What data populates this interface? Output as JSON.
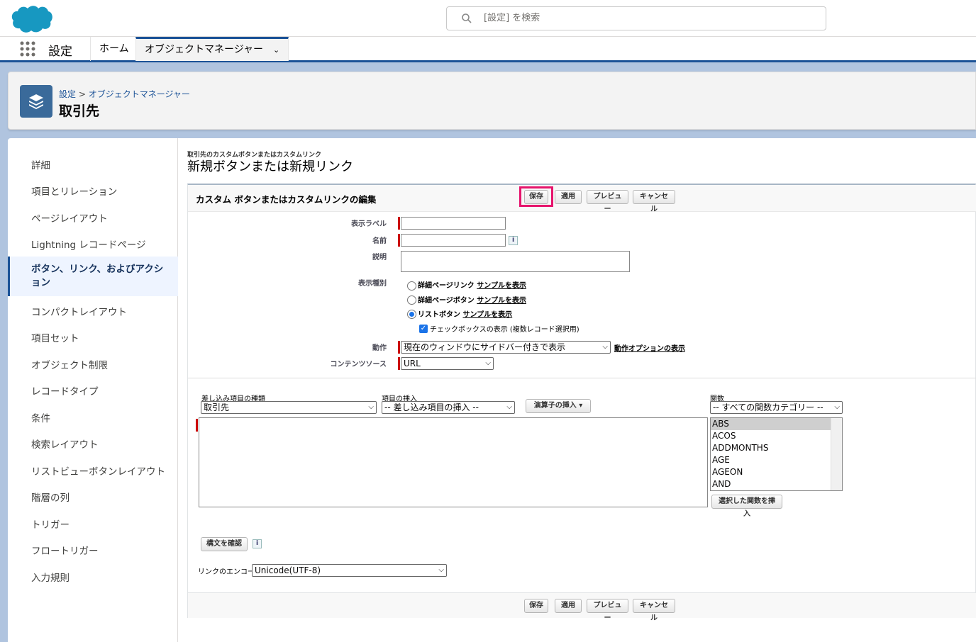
{
  "header": {
    "search_placeholder": "[設定] を検索"
  },
  "nav": {
    "app_name": "設定",
    "tabs": [
      {
        "label": "ホーム"
      },
      {
        "label": "オブジェクトマネージャー"
      }
    ]
  },
  "page_header": {
    "breadcrumb_setup": "設定",
    "breadcrumb_sep": ">",
    "breadcrumb_objmgr": "オブジェクトマネージャー",
    "title": "取引先"
  },
  "sidebar": {
    "items": [
      {
        "label": "詳細"
      },
      {
        "label": "項目とリレーション"
      },
      {
        "label": "ページレイアウト"
      },
      {
        "label": "Lightning レコードページ"
      },
      {
        "label": "ボタン、リンク、およびアクション"
      },
      {
        "label": "コンパクトレイアウト"
      },
      {
        "label": "項目セット"
      },
      {
        "label": "オブジェクト制限"
      },
      {
        "label": "レコードタイプ"
      },
      {
        "label": "条件"
      },
      {
        "label": "検索レイアウト"
      },
      {
        "label": "リストビューボタンレイアウト"
      },
      {
        "label": "階層の列"
      },
      {
        "label": "トリガー"
      },
      {
        "label": "フロートリガー"
      },
      {
        "label": "入力規則"
      }
    ],
    "active_index": 4
  },
  "content": {
    "subtitle": "取引先のカスタムボタンまたはカスタムリンク",
    "title": "新規ボタンまたは新規リンク",
    "block_title": "カスタム ボタンまたはカスタムリンクの編集",
    "buttons": {
      "save": "保存",
      "apply": "適用",
      "preview": "プレビュー",
      "cancel": "キャンセル"
    },
    "fields": {
      "display_label": "表示ラベル",
      "name": "名前",
      "description": "説明",
      "display_type": "表示種別",
      "behavior": "動作",
      "content_source": "コンテンツソース"
    },
    "display_type_options": [
      {
        "label": "詳細ページリンク",
        "sample": "サンプルを表示",
        "checked": false
      },
      {
        "label": "詳細ページボタン",
        "sample": "サンプルを表示",
        "checked": false
      },
      {
        "label": "リストボタン",
        "sample": "サンプルを表示",
        "checked": true
      }
    ],
    "checkbox_label": "チェックボックスの表示 (複数レコード選択用)",
    "checkbox_checked": true,
    "behavior_value": "現在のウィンドウにサイドバー付きで表示",
    "behavior_link": "動作オプションの表示",
    "content_source_value": "URL",
    "merge_type_label": "差し込み項目の種類",
    "merge_type_value": "取引先",
    "insert_field_label": "項目の挿入",
    "insert_field_value": "-- 差し込み項目の挿入 --",
    "insert_operator": "演算子の挿入",
    "functions_label": "関数",
    "functions_category": "-- すべての関数カテゴリー --",
    "functions_list": [
      "ABS",
      "ACOS",
      "ADDMONTHS",
      "AGE",
      "AGEON",
      "AND"
    ],
    "functions_selected": "ABS",
    "insert_function_button": "選択した関数を挿入",
    "check_syntax_button": "構文を確認",
    "encoding_label": "リンクのエンコード",
    "encoding_value": "Unicode(UTF-8)"
  },
  "colors": {
    "brand": "#1b5297",
    "highlight": "#e6146c",
    "required": "#cc0000"
  }
}
